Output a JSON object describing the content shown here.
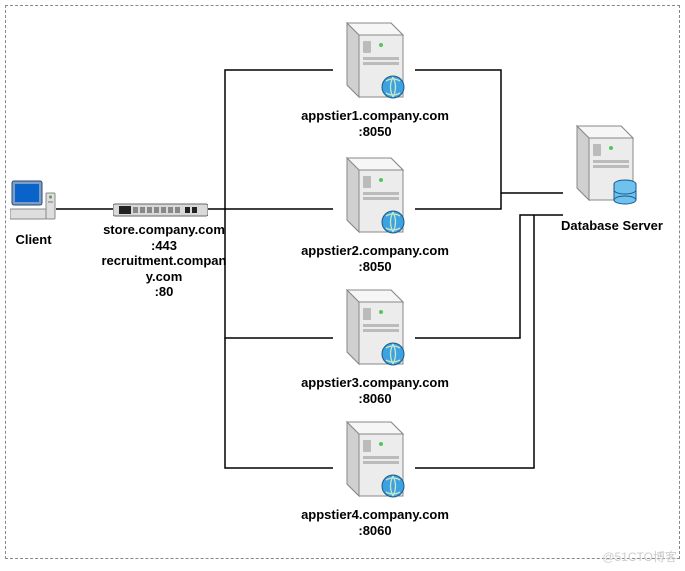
{
  "diagram": {
    "client_label": "Client",
    "loadbalancer_label": "store.company.com\n:443\nrecruitment.compan\ny.com\n:80",
    "app1_label": "appstier1.company.com\n:8050",
    "app2_label": "appstier2.company.com\n:8050",
    "app3_label": "appstier3.company.com\n:8060",
    "app4_label": "appstier4.company.com\n:8060",
    "db_label": "Database Server"
  },
  "watermark": "@51CTO博客"
}
